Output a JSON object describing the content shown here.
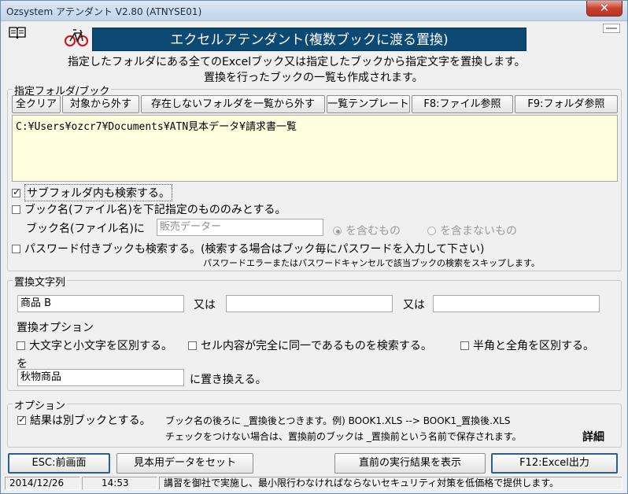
{
  "window": {
    "title": "Ozsystem アテンダント V2.80 (ATNYSE01)",
    "close_label": "✕"
  },
  "header": {
    "banner": "エクセルアテンダント(複数ブックに渡る置換)",
    "desc1": "指定したフォルダにある全てのExcelブック又は指定したブックから指定文字を置換します。",
    "desc2": "置換を行ったブックの一覧も作成されます。"
  },
  "folder_group": {
    "label": "指定フォルダ/ブック",
    "buttons": [
      "全クリア",
      "対象から外す",
      "存在しないフォルダを一覧から外す",
      "一覧テンプレート",
      "F8:ファイル参照",
      "F9:フォルダ参照"
    ],
    "path": "C:¥Users¥ozcr7¥Documents¥ATN見本データ¥請求書一覧",
    "subfolder_label": "サブフォルダ内も検索する。",
    "subfolder_checked": true,
    "bookname_only_label": "ブック名(ファイル名)を下記指定のもののみとする。",
    "bookname_only_checked": false,
    "bookname_field_label": "ブック名(ファイル名)に",
    "bookname_value": "販売データー",
    "radio_contains": "を含むもの",
    "radio_not_contains": "を含まないもの",
    "password_label": "パスワード付きブックも検索する。(検索する場合はブック毎にパスワードを入力して下さい)",
    "password_checked": false,
    "password_note": "パスワードエラーまたはパスワードキャンセルで該当ブックの検索をスキップします。"
  },
  "replace_group": {
    "label": "置換文字列",
    "search1": "商品 B",
    "or1": "又は",
    "search2": "",
    "or2": "又は",
    "search3": "",
    "options_label": "置換オプション",
    "opt_case": "大文字と小文字を区別する。",
    "opt_exact": "セル内容が完全に同一であるものを検索する。",
    "opt_width": "半角と全角を区別する。",
    "to_label": "を",
    "replace_value": "秋物商品",
    "replace_suffix": "に置き換える。"
  },
  "options_group": {
    "label": "オプション",
    "separate_label": "結果は別ブックとする。",
    "separate_checked": true,
    "note1": "ブック名の後ろに _置換後とつきます。例) BOOK1.XLS --> BOOK1_置換後.XLS",
    "note2": "チェックをつけない場合は、置換前のブックは _置換前という名前で保存されます。",
    "detail": "詳細"
  },
  "footer": {
    "back": "ESC:前画面",
    "sample": "見本用データをセット",
    "last_result": "直前の実行結果を表示",
    "excel": "F12:Excel出力"
  },
  "status": {
    "date": "2014/12/26",
    "time": "14:53",
    "message": "講習を御社で実施し、最小限行わなければならないセキュリティ対策を低価格で提供します。"
  },
  "icons": {
    "book": "book-icon",
    "bicycle": "bicycle-icon"
  }
}
